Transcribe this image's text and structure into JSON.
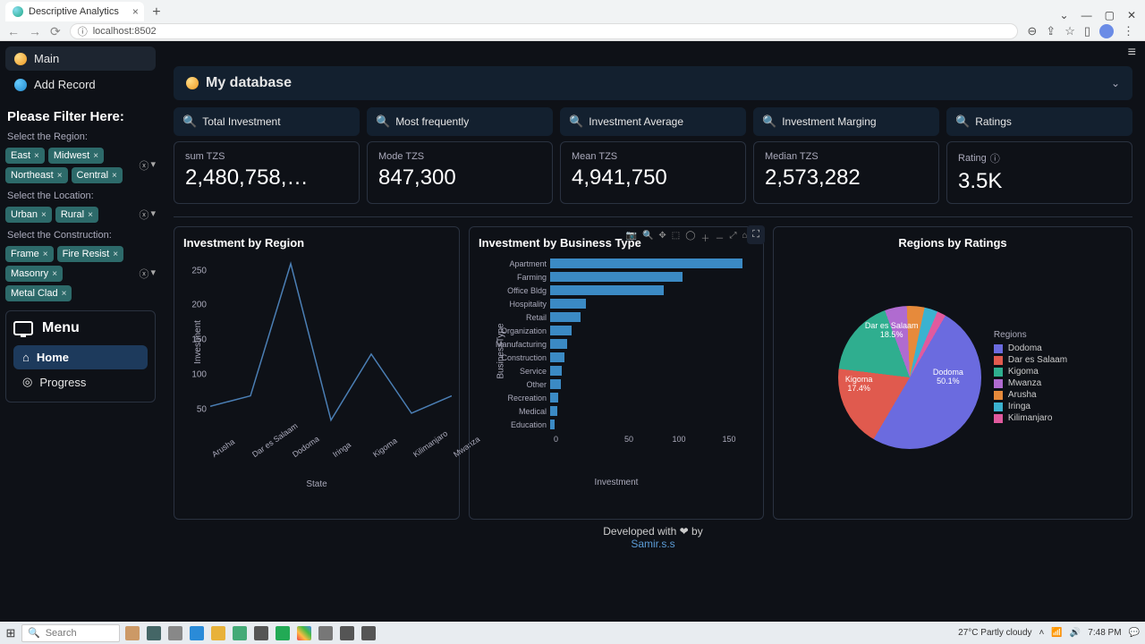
{
  "browser": {
    "tab_title": "Descriptive Analytics",
    "url_host": "localhost:8502",
    "url_icon": "ⓘ"
  },
  "sidebar": {
    "nav": [
      {
        "label": "Main",
        "active": true
      },
      {
        "label": "Add Record",
        "active": false
      }
    ],
    "filter_header": "Please Filter Here:",
    "region_label": "Select the Region:",
    "regions": [
      "East",
      "Midwest",
      "Northeast",
      "Central"
    ],
    "location_label": "Select the Location:",
    "locations": [
      "Urban",
      "Rural"
    ],
    "construction_label": "Select the Construction:",
    "constructions": [
      "Frame",
      "Fire Resist",
      "Masonry",
      "Metal Clad"
    ],
    "menu_title": "Menu",
    "menu_items": [
      {
        "label": "Home",
        "icon": "⌂",
        "active": true
      },
      {
        "label": "Progress",
        "icon": "◎",
        "active": false
      }
    ]
  },
  "header": {
    "db_title": "My database"
  },
  "kpis": [
    {
      "hdr": "Total Investment",
      "sub": "sum TZS",
      "val": "2,480,758,…"
    },
    {
      "hdr": "Most frequently",
      "sub": "Mode TZS",
      "val": "847,300"
    },
    {
      "hdr": "Investment Average",
      "sub": "Mean TZS",
      "val": "4,941,750"
    },
    {
      "hdr": "Investment Marging",
      "sub": "Median TZS",
      "val": "2,573,282"
    },
    {
      "hdr": "Ratings",
      "sub": "Rating",
      "val": "3.5K",
      "info": true
    }
  ],
  "charts": {
    "region": {
      "title": "Investment by Region",
      "xlabel": "State",
      "ylabel": "Investment"
    },
    "biztype": {
      "title": "Investment by Business Type",
      "xlabel": "Investment",
      "ylabel": "BusinessType"
    },
    "pie": {
      "title": "Regions by Ratings",
      "legend_header": "Regions"
    }
  },
  "footer": {
    "text": "Developed with ❤ by",
    "author": "Samir.s.s"
  },
  "taskbar": {
    "search": "Search",
    "weather": "27°C  Partly cloudy",
    "time": "7:48 PM"
  },
  "chart_data": [
    {
      "type": "line",
      "title": "Investment by Region",
      "xlabel": "State",
      "ylabel": "Investment",
      "categories": [
        "Arusha",
        "Dar es Salaam",
        "Dodoma",
        "Iringa",
        "Kigoma",
        "Kilimanjaro",
        "Mwanza"
      ],
      "values": [
        55,
        70,
        260,
        35,
        130,
        45,
        70
      ],
      "ylim": [
        0,
        270
      ],
      "yticks": [
        50,
        100,
        150,
        200,
        250
      ]
    },
    {
      "type": "bar",
      "orientation": "horizontal",
      "title": "Investment by Business Type",
      "xlabel": "Investment",
      "ylabel": "BusinessType",
      "categories": [
        "Apartment",
        "Farming",
        "Office Bldg",
        "Hospitality",
        "Retail",
        "Organization",
        "Manufacturing",
        "Construction",
        "Service",
        "Other",
        "Recreation",
        "Medical",
        "Education"
      ],
      "values": [
        160,
        110,
        95,
        30,
        25,
        18,
        14,
        12,
        10,
        9,
        7,
        6,
        4
      ],
      "xlim": [
        0,
        170
      ],
      "xticks": [
        0,
        50,
        100,
        150
      ]
    },
    {
      "type": "pie",
      "title": "Regions by Ratings",
      "series": [
        {
          "name": "Dodoma",
          "value": 50.1,
          "color": "#6b6bdf"
        },
        {
          "name": "Dar es Salaam",
          "value": 18.5,
          "color": "#e05a4e"
        },
        {
          "name": "Kigoma",
          "value": 17.4,
          "color": "#2fae8f"
        },
        {
          "name": "Mwanza",
          "value": 5.0,
          "color": "#b06bd0"
        },
        {
          "name": "Arusha",
          "value": 4.0,
          "color": "#e68a3b"
        },
        {
          "name": "Iringa",
          "value": 3.0,
          "color": "#3bb2d0"
        },
        {
          "name": "Kilimanjaro",
          "value": 2.0,
          "color": "#e05a9e"
        }
      ]
    }
  ]
}
